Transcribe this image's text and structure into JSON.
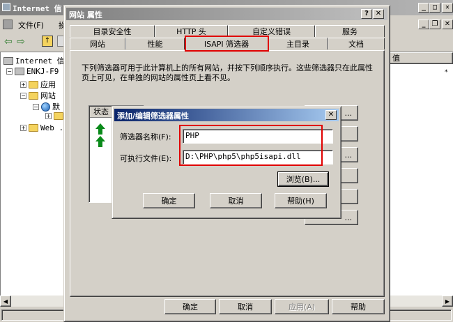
{
  "mmc": {
    "title": "Internet 信",
    "menu": {
      "file": "文件(F)",
      "action": "操"
    },
    "tree": {
      "root": "Internet 信",
      "server": "ENKJ-F9",
      "app_pools": "应用",
      "websites": "网站",
      "default_site_glyph": "默",
      "web_ext": "Web ."
    },
    "right_header": "值"
  },
  "props": {
    "title": "网站 属性",
    "tabs_row1": [
      "目录安全性",
      "HTTP 头",
      "自定义错误",
      "服务"
    ],
    "tabs_row2": [
      "网站",
      "性能",
      "ISAPI 筛选器",
      "主目录",
      "文档"
    ],
    "active_tab": "ISAPI 筛选器",
    "description": "下列筛选器可用于此计算机上的所有网站，并按下列顺序执行。这些筛选器只在此属性页上可见，在单独的网站的属性页上看不见。",
    "list_header": "状态",
    "side_buttons": [
      "...",
      "",
      "...",
      "",
      "",
      "..."
    ],
    "buttons": {
      "ok": "确定",
      "cancel": "取消",
      "apply": "应用(A)",
      "help": "帮助"
    }
  },
  "edit": {
    "title": "添加/编辑筛选器属性",
    "name_label": "筛选器名称(F):",
    "name_value": "PHP",
    "exe_label": "可执行文件(E):",
    "exe_value": "D:\\PHP\\php5\\php5isapi.dll",
    "browse": "浏览(B)...",
    "ok": "确定",
    "cancel": "取消",
    "help": "帮助(H)"
  },
  "colors": {
    "highlight": "#e00000",
    "arrow": "#0a8a1a",
    "active_title": "#0a246a"
  }
}
